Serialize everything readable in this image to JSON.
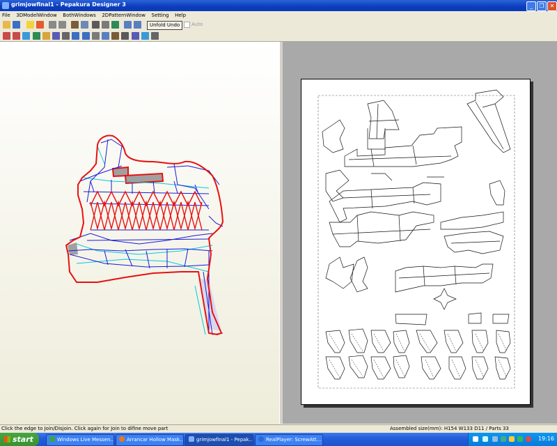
{
  "window": {
    "title": "grimjowfinal1 - Pepakura Designer 3",
    "controls": {
      "minimize": "_",
      "maximize": "❐",
      "close": "✕"
    }
  },
  "menu": [
    "File",
    "3DModelWindow",
    "BothWindows",
    "2DPatternWindow",
    "Setting",
    "Help"
  ],
  "toolbar": {
    "unfold_undo_label": "Unfold Undo",
    "auto_label": "Auto",
    "row1_icons": [
      {
        "name": "open-icon",
        "color": "#E8B84A"
      },
      {
        "name": "save-icon",
        "color": "#3A6FC4"
      },
      {
        "name": "bulb-icon",
        "color": "#F5D23C"
      },
      {
        "name": "cube-color-icon",
        "color": "#E25C2E"
      },
      {
        "name": "undo-icon",
        "color": "#8A8A8A"
      },
      {
        "name": "redo-icon",
        "color": "#8A8A8A"
      },
      {
        "name": "pencil-icon",
        "color": "#7A5C3A"
      },
      {
        "name": "layers-icon",
        "color": "#6C8AB5"
      },
      {
        "name": "anchor-icon",
        "color": "#5A5A5A"
      },
      {
        "name": "columns-icon",
        "color": "#7A7A7A"
      },
      {
        "name": "flag-icon",
        "color": "#2E8B57"
      },
      {
        "name": "frame-icon",
        "color": "#5A7EC0"
      },
      {
        "name": "window-icon",
        "color": "#5A7EC0"
      }
    ],
    "row2_icons": [
      {
        "name": "select-icon",
        "color": "#C84A4A"
      },
      {
        "name": "edge-select-icon",
        "color": "#C84A4A"
      },
      {
        "name": "picture-icon",
        "color": "#3A9AD9"
      },
      {
        "name": "paper-icon",
        "color": "#2E8B57"
      },
      {
        "name": "book-icon",
        "color": "#D9A53A"
      },
      {
        "name": "edit-icon",
        "color": "#5A5AB5"
      },
      {
        "name": "print-icon",
        "color": "#666666"
      },
      {
        "name": "rotate-icon",
        "color": "#3A6FC4"
      },
      {
        "name": "flip-icon",
        "color": "#3A6FC4"
      },
      {
        "name": "move-icon",
        "color": "#7A7A7A"
      },
      {
        "name": "arrange-icon",
        "color": "#5A7EC0"
      },
      {
        "name": "join-icon",
        "color": "#7A5C3A"
      },
      {
        "name": "text-icon",
        "color": "#5A5A5A"
      },
      {
        "name": "grid-icon",
        "color": "#5A5AB5"
      },
      {
        "name": "image-icon",
        "color": "#3A9AD9"
      },
      {
        "name": "printer-icon",
        "color": "#666666"
      }
    ]
  },
  "status": {
    "hint": "Click the edge to Join/Disjoin. Click again for Join to difine move part",
    "assembled": "Assembled size(mm): H154 W133 D11 / Parts 33"
  },
  "taskbar": {
    "start_label": "start",
    "tasks": [
      {
        "label": "Windows Live Messen...",
        "icon": "messenger-icon",
        "color": "#3BA54A",
        "active": false
      },
      {
        "label": "Arrancar Hollow Mask...",
        "icon": "firefox-icon",
        "color": "#E8771C",
        "active": false
      },
      {
        "label": "grimjowfinal1 - Pepak...",
        "icon": "pepakura-icon",
        "color": "#7fb0ff",
        "active": true
      },
      {
        "label": "RealPlayer: ScrewAtt...",
        "icon": "realplayer-icon",
        "color": "#2B6AD6",
        "active": false
      }
    ],
    "clock": "19:16"
  },
  "colors": {
    "cut_line": "#E81010",
    "mesh_line": "#1A1AD8",
    "fold_line": "#00C8E0",
    "selected_face": "#A0A0A0"
  }
}
